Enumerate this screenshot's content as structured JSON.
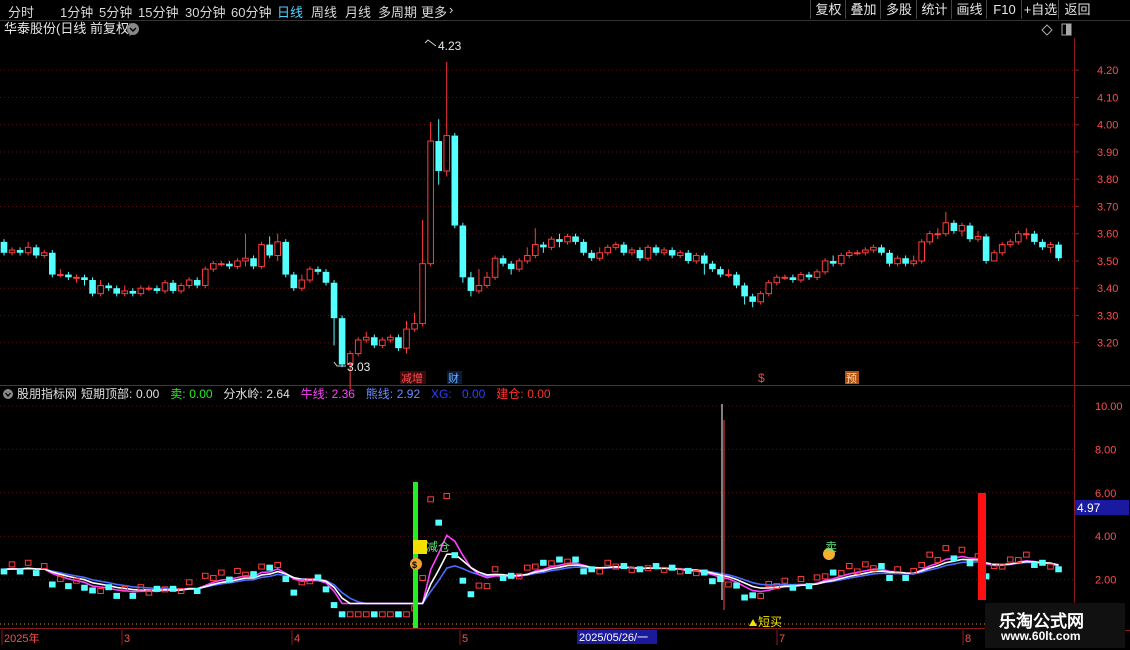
{
  "toolbar": {
    "periods": [
      "分时",
      "1分钟",
      "5分钟",
      "15分钟",
      "30分钟",
      "60分钟",
      "日线",
      "周线",
      "月线",
      "多周期",
      "更多"
    ],
    "active_period": "日线",
    "buttons": [
      "复权",
      "叠加",
      "多股",
      "统计",
      "画线",
      "F10",
      "+自选",
      "返回"
    ]
  },
  "main_chart": {
    "title": "华泰股份(日线 前复权)",
    "high_label": "4.23",
    "low_label": "3.03",
    "y_ticks": [
      "4.20",
      "4.10",
      "4.00",
      "3.90",
      "3.80",
      "3.70",
      "3.60",
      "3.50",
      "3.40",
      "3.30",
      "3.20"
    ],
    "event_markers": [
      "减增",
      "财",
      "$",
      "预"
    ]
  },
  "indicator": {
    "name": "股朋指标网",
    "params": [
      {
        "label": "短期顶部:",
        "value": "0.00",
        "color": "#e0e0e0"
      },
      {
        "label": "卖:",
        "value": "0.00",
        "color": "#22ee22"
      },
      {
        "label": "分水岭:",
        "value": "2.64",
        "color": "#e0e0e0"
      },
      {
        "label": "牛线:",
        "value": "2.36",
        "color": "#ff40ff"
      },
      {
        "label": "熊线:",
        "value": "2.92",
        "color": "#6a8cff"
      },
      {
        "label": "XG:",
        "value": "0.00",
        "color": "#2f3fff"
      },
      {
        "label": "建仓:",
        "value": "0.00",
        "color": "#ff3030"
      }
    ],
    "y_ticks": [
      "10.00",
      "8.00",
      "6.00",
      "4.00",
      "2.00"
    ],
    "current_value": "4.97",
    "labels": {
      "reduce": "减仓",
      "short_buy": "短买",
      "sell": "卖"
    }
  },
  "date_axis": {
    "labels": [
      "2025年",
      "3",
      "4",
      "5",
      "7",
      "8"
    ],
    "cursor_date": "2025/05/26/一"
  },
  "watermark": {
    "name": "乐淘公式网",
    "url": "www.60lt.com"
  },
  "chart_data": {
    "type": "candlestick",
    "title": "华泰股份(日线 前复权)",
    "ylim": [
      3.03,
      4.23
    ],
    "y_ticks": [
      3.2,
      3.3,
      3.4,
      3.5,
      3.6,
      3.7,
      3.8,
      3.9,
      4.0,
      4.1,
      4.2
    ],
    "annotations": {
      "high": 4.23,
      "low": 3.03
    },
    "colors": {
      "up": "#ff3c3c",
      "down": "#54ffff",
      "bg": "#000000"
    },
    "candles": [
      [
        3.57,
        3.53,
        3.58,
        3.52
      ],
      [
        3.53,
        3.54,
        3.55,
        3.52
      ],
      [
        3.54,
        3.53,
        3.55,
        3.52
      ],
      [
        3.53,
        3.55,
        3.57,
        3.52
      ],
      [
        3.55,
        3.52,
        3.56,
        3.51
      ],
      [
        3.52,
        3.53,
        3.54,
        3.51
      ],
      [
        3.53,
        3.45,
        3.54,
        3.44
      ],
      [
        3.45,
        3.45,
        3.47,
        3.44
      ],
      [
        3.45,
        3.44,
        3.46,
        3.43
      ],
      [
        3.44,
        3.44,
        3.45,
        3.42
      ],
      [
        3.44,
        3.43,
        3.45,
        3.41
      ],
      [
        3.43,
        3.38,
        3.44,
        3.37
      ],
      [
        3.38,
        3.41,
        3.43,
        3.37
      ],
      [
        3.41,
        3.4,
        3.42,
        3.39
      ],
      [
        3.4,
        3.38,
        3.41,
        3.37
      ],
      [
        3.38,
        3.39,
        3.41,
        3.37
      ],
      [
        3.39,
        3.38,
        3.4,
        3.37
      ],
      [
        3.38,
        3.4,
        3.41,
        3.37
      ],
      [
        3.4,
        3.4,
        3.41,
        3.39
      ],
      [
        3.4,
        3.39,
        3.41,
        3.38
      ],
      [
        3.39,
        3.42,
        3.43,
        3.38
      ],
      [
        3.42,
        3.39,
        3.43,
        3.38
      ],
      [
        3.39,
        3.41,
        3.42,
        3.38
      ],
      [
        3.41,
        3.43,
        3.44,
        3.4
      ],
      [
        3.43,
        3.41,
        3.44,
        3.4
      ],
      [
        3.41,
        3.47,
        3.48,
        3.4
      ],
      [
        3.47,
        3.49,
        3.5,
        3.46
      ],
      [
        3.49,
        3.49,
        3.5,
        3.48
      ],
      [
        3.49,
        3.48,
        3.5,
        3.47
      ],
      [
        3.48,
        3.5,
        3.51,
        3.47
      ],
      [
        3.5,
        3.51,
        3.6,
        3.48
      ],
      [
        3.51,
        3.48,
        3.52,
        3.47
      ],
      [
        3.48,
        3.56,
        3.57,
        3.47
      ],
      [
        3.56,
        3.52,
        3.59,
        3.51
      ],
      [
        3.52,
        3.57,
        3.6,
        3.5
      ],
      [
        3.57,
        3.45,
        3.58,
        3.44
      ],
      [
        3.45,
        3.4,
        3.46,
        3.39
      ],
      [
        3.4,
        3.43,
        3.45,
        3.39
      ],
      [
        3.43,
        3.47,
        3.48,
        3.42
      ],
      [
        3.47,
        3.46,
        3.48,
        3.45
      ],
      [
        3.46,
        3.42,
        3.47,
        3.41
      ],
      [
        3.42,
        3.29,
        3.43,
        3.19
      ],
      [
        3.29,
        3.12,
        3.3,
        3.11
      ],
      [
        3.12,
        3.16,
        3.17,
        3.03
      ],
      [
        3.16,
        3.21,
        3.22,
        3.15
      ],
      [
        3.21,
        3.22,
        3.24,
        3.2
      ],
      [
        3.22,
        3.19,
        3.23,
        3.18
      ],
      [
        3.19,
        3.21,
        3.22,
        3.18
      ],
      [
        3.21,
        3.22,
        3.23,
        3.2
      ],
      [
        3.22,
        3.18,
        3.23,
        3.17
      ],
      [
        3.18,
        3.25,
        3.28,
        3.16
      ],
      [
        3.25,
        3.27,
        3.31,
        3.24
      ],
      [
        3.27,
        3.49,
        3.65,
        3.26
      ],
      [
        3.49,
        3.94,
        4.01,
        3.48
      ],
      [
        3.94,
        3.83,
        4.02,
        3.78
      ],
      [
        3.83,
        3.96,
        4.23,
        3.81
      ],
      [
        3.96,
        3.63,
        3.97,
        3.62
      ],
      [
        3.63,
        3.44,
        3.64,
        3.42
      ],
      [
        3.44,
        3.39,
        3.46,
        3.37
      ],
      [
        3.39,
        3.41,
        3.47,
        3.38
      ],
      [
        3.41,
        3.44,
        3.46,
        3.4
      ],
      [
        3.44,
        3.51,
        3.52,
        3.43
      ],
      [
        3.51,
        3.49,
        3.52,
        3.48
      ],
      [
        3.49,
        3.47,
        3.5,
        3.45
      ],
      [
        3.47,
        3.5,
        3.51,
        3.46
      ],
      [
        3.5,
        3.52,
        3.55,
        3.49
      ],
      [
        3.52,
        3.56,
        3.62,
        3.51
      ],
      [
        3.56,
        3.55,
        3.57,
        3.53
      ],
      [
        3.55,
        3.58,
        3.59,
        3.54
      ],
      [
        3.58,
        3.57,
        3.6,
        3.55
      ],
      [
        3.57,
        3.59,
        3.6,
        3.56
      ],
      [
        3.59,
        3.57,
        3.6,
        3.56
      ],
      [
        3.57,
        3.53,
        3.58,
        3.52
      ],
      [
        3.53,
        3.51,
        3.54,
        3.5
      ],
      [
        3.51,
        3.53,
        3.55,
        3.5
      ],
      [
        3.53,
        3.55,
        3.56,
        3.52
      ],
      [
        3.55,
        3.56,
        3.57,
        3.54
      ],
      [
        3.56,
        3.53,
        3.57,
        3.52
      ],
      [
        3.53,
        3.54,
        3.55,
        3.52
      ],
      [
        3.54,
        3.51,
        3.55,
        3.5
      ],
      [
        3.51,
        3.55,
        3.56,
        3.5
      ],
      [
        3.55,
        3.53,
        3.56,
        3.52
      ],
      [
        3.53,
        3.54,
        3.55,
        3.52
      ],
      [
        3.54,
        3.52,
        3.55,
        3.51
      ],
      [
        3.52,
        3.53,
        3.54,
        3.51
      ],
      [
        3.53,
        3.5,
        3.54,
        3.49
      ],
      [
        3.5,
        3.52,
        3.53,
        3.49
      ],
      [
        3.52,
        3.49,
        3.53,
        3.45
      ],
      [
        3.49,
        3.47,
        3.5,
        3.46
      ],
      [
        3.47,
        3.45,
        3.48,
        3.44
      ],
      [
        3.45,
        3.45,
        3.47,
        3.44
      ],
      [
        3.45,
        3.41,
        3.46,
        3.4
      ],
      [
        3.41,
        3.37,
        3.42,
        3.34
      ],
      [
        3.37,
        3.35,
        3.38,
        3.33
      ],
      [
        3.35,
        3.38,
        3.39,
        3.34
      ],
      [
        3.38,
        3.42,
        3.43,
        3.37
      ],
      [
        3.42,
        3.44,
        3.45,
        3.41
      ],
      [
        3.44,
        3.44,
        3.45,
        3.43
      ],
      [
        3.44,
        3.43,
        3.45,
        3.42
      ],
      [
        3.43,
        3.45,
        3.46,
        3.42
      ],
      [
        3.45,
        3.44,
        3.46,
        3.43
      ],
      [
        3.44,
        3.46,
        3.47,
        3.43
      ],
      [
        3.46,
        3.5,
        3.51,
        3.45
      ],
      [
        3.5,
        3.49,
        3.52,
        3.48
      ],
      [
        3.49,
        3.52,
        3.53,
        3.48
      ],
      [
        3.52,
        3.53,
        3.54,
        3.51
      ],
      [
        3.53,
        3.53,
        3.54,
        3.52
      ],
      [
        3.53,
        3.54,
        3.55,
        3.52
      ],
      [
        3.54,
        3.55,
        3.56,
        3.53
      ],
      [
        3.55,
        3.53,
        3.56,
        3.52
      ],
      [
        3.53,
        3.49,
        3.54,
        3.48
      ],
      [
        3.49,
        3.51,
        3.52,
        3.48
      ],
      [
        3.51,
        3.49,
        3.52,
        3.48
      ],
      [
        3.49,
        3.5,
        3.52,
        3.48
      ],
      [
        3.5,
        3.57,
        3.58,
        3.49
      ],
      [
        3.57,
        3.6,
        3.61,
        3.56
      ],
      [
        3.6,
        3.6,
        3.62,
        3.58
      ],
      [
        3.6,
        3.64,
        3.68,
        3.59
      ],
      [
        3.64,
        3.61,
        3.65,
        3.6
      ],
      [
        3.61,
        3.63,
        3.64,
        3.59
      ],
      [
        3.63,
        3.58,
        3.64,
        3.57
      ],
      [
        3.58,
        3.59,
        3.61,
        3.57
      ],
      [
        3.59,
        3.5,
        3.6,
        3.49
      ],
      [
        3.5,
        3.53,
        3.54,
        3.5
      ],
      [
        3.53,
        3.56,
        3.57,
        3.52
      ],
      [
        3.56,
        3.57,
        3.58,
        3.55
      ],
      [
        3.57,
        3.6,
        3.61,
        3.56
      ],
      [
        3.6,
        3.6,
        3.62,
        3.58
      ],
      [
        3.6,
        3.57,
        3.61,
        3.56
      ],
      [
        3.57,
        3.55,
        3.58,
        3.54
      ],
      [
        3.55,
        3.56,
        3.57,
        3.53
      ],
      [
        3.56,
        3.51,
        3.57,
        3.5
      ]
    ]
  }
}
